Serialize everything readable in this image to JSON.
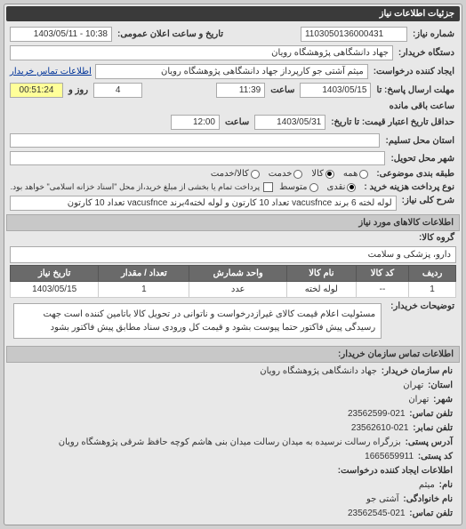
{
  "panel_title": "جزئیات اطلاعات نیاز",
  "header": {
    "req_no_label": "شماره نیاز:",
    "req_no": "1103050136000431",
    "announce_label": "تاریخ و ساعت اعلان عمومی:",
    "announce_value": "10:38 - 1403/05/11",
    "buyer_label": "دستگاه خریدار:",
    "buyer_value": "جهاد دانشگاهی پژوهشگاه رویان",
    "creator_label": "ایجاد کننده درخواست:",
    "creator_value": "میثم  آشتی جو کارپرداز جهاد دانشگاهی پژوهشگاه رویان",
    "buyer_contact_link": "اطلاعات تماس خریدار",
    "deadline_label": "مهلت ارسال پاسخ: تا",
    "deadline_date": "1403/05/15",
    "time_label": "ساعت",
    "deadline_time": "11:39",
    "day_and_label": "روز و",
    "remaining_days": "4",
    "remaining_time": "00:51:24",
    "remaining_label": "ساعت باقی مانده",
    "validity_label": "حداقل تاریخ اعتبار قیمت: تا تاریخ:",
    "validity_date": "1403/05/31",
    "validity_time": "12:00",
    "service_loc_label": "استان محل تسلیم:",
    "delivery_loc_label": "شهر محل تحویل:",
    "cat_label": "طبقه بندی موضوعی:",
    "cat_all": "همه",
    "cat_goods": "کالا",
    "cat_service": "خدمت",
    "cat_both": "کالا/خدمت",
    "pay_label": "نوع پرداخت هزینه خرید :",
    "pay_cash": "نقدی",
    "pay_mid": "متوسط",
    "pay_note": "پرداخت تمام یا بخشی از مبلغ خرید،از محل \"اسناد خزانه اسلامی\" خواهد بود."
  },
  "desc": {
    "label": "شرح کلی نیاز:",
    "text": "لوله لخته 6 برند vacusfnce تعداد 10 کارتون و لوله لخته4برند vacusfnce تعداد 10 کارتون"
  },
  "goods": {
    "section_title": "اطلاعات کالاهای مورد نیاز",
    "group_label": "گروه کالا:",
    "group_value": "دارو، پزشکی و سلامت",
    "columns": [
      "ردیف",
      "کد کالا",
      "نام کالا",
      "واحد شمارش",
      "تعداد / مقدار",
      "تاریخ نیاز"
    ],
    "rows": [
      {
        "idx": "1",
        "code": "--",
        "name": "لوله لخته",
        "unit": "عدد",
        "qty": "1",
        "date": "1403/05/15"
      }
    ]
  },
  "buyer_desc": {
    "label": "توضیحات خریدار:",
    "text": "مسئولیت اعلام قیمت کالای غیرازدرخواست و ناتوانی در تحویل کالا باتامین کننده است جهت رسیدگی پیش فاکتور حتما پیوست بشود و قیمت کل ورودی سناد مطابق پیش فاکتور بشود"
  },
  "contact": {
    "section_title": "اطلاعات تماس سازمان خریدار:",
    "org_label": "نام سازمان خریدار:",
    "org_value": "جهاد دانشگاهی پژوهشگاه رویان",
    "province_label": "استان:",
    "province_value": "تهران",
    "city_label": "شهر:",
    "city_value": "تهران",
    "phone_label": "تلفن تماس:",
    "phone_value": "021-23562599",
    "fax_label": "تلفن نمابر:",
    "fax_value": "021-23562610",
    "address_label": "آدرس پستی:",
    "address_value": "بزرگراه رسالت نرسیده به میدان رسالت میدان بنی هاشم کوچه حافظ شرقی پژوهشگاه رویان",
    "postal_label": "کد پستی:",
    "postal_value": "1665659911",
    "req_creator_label": "اطلاعات ایجاد کننده درخواست:",
    "person_label": "نام:",
    "person_value": "میثم",
    "family_label": "نام خانوادگی:",
    "family_value": "آشتی جو",
    "person_phone_label": "تلفن تماس:",
    "person_phone_value": "021-23562545"
  }
}
